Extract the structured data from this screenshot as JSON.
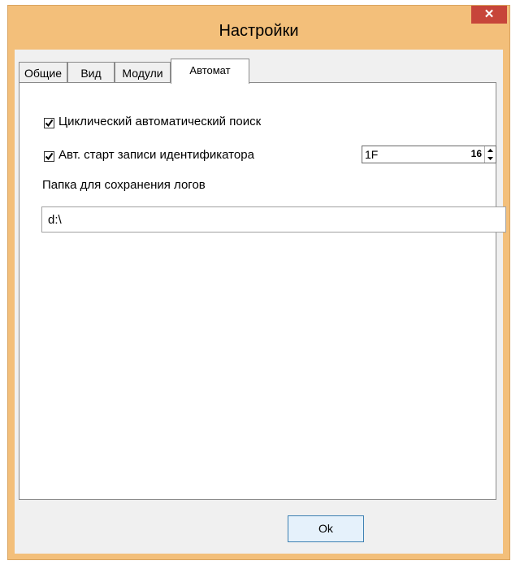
{
  "window": {
    "title": "Настройки",
    "close_icon": "✕"
  },
  "tabs": [
    {
      "label": "Общие",
      "active": false
    },
    {
      "label": "Вид",
      "active": false
    },
    {
      "label": "Модули",
      "active": false
    },
    {
      "label": "Автомат",
      "active": true
    }
  ],
  "automat": {
    "cyclic_search": {
      "label": "Циклический автоматический поиск",
      "checked": true
    },
    "auto_start": {
      "label": "Авт. старт записи идентификатора",
      "checked": true
    },
    "identifier": {
      "value": "1F",
      "base": "16"
    },
    "log_folder": {
      "label": "Папка для сохранения логов",
      "value": "d:\\"
    }
  },
  "buttons": {
    "ok": "Ok"
  },
  "colors": {
    "frame": "#f3bf7a",
    "close": "#c7453a",
    "ok_bg": "#e5f1fb",
    "ok_border": "#3c7fb1"
  }
}
